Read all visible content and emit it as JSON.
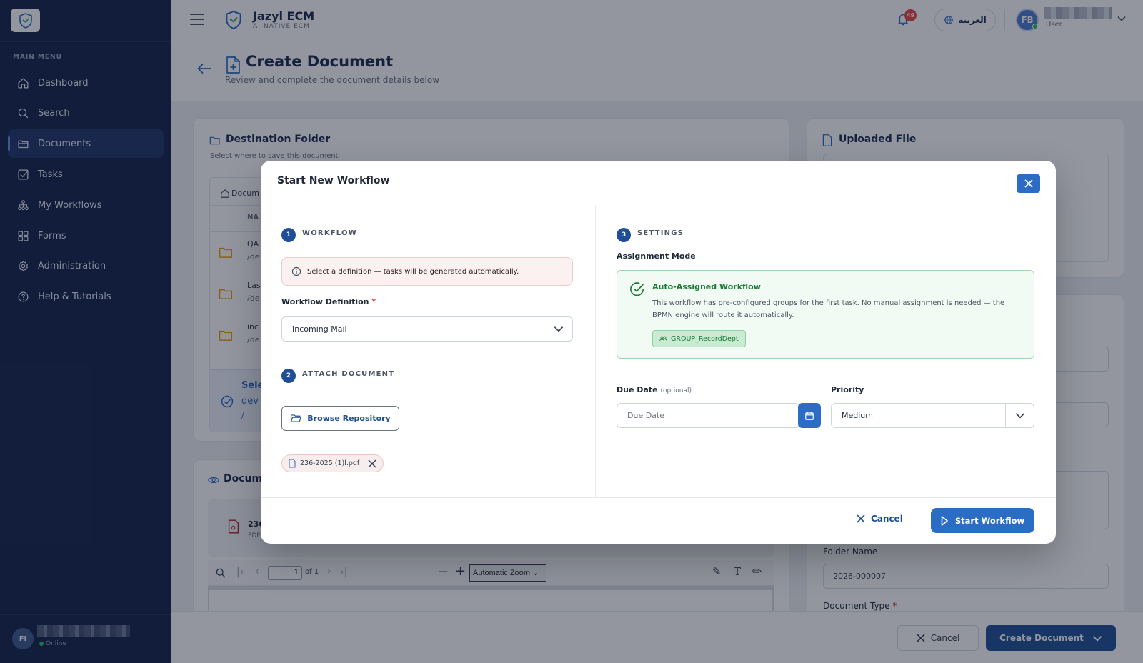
{
  "sidebar": {
    "menu_label": "MAIN MENU",
    "items": [
      {
        "label": "Dashboard",
        "icon": "home-icon"
      },
      {
        "label": "Search",
        "icon": "search-icon"
      },
      {
        "label": "Documents",
        "icon": "folder-icon",
        "active": true
      },
      {
        "label": "Tasks",
        "icon": "checkbox-icon"
      },
      {
        "label": "My Workflows",
        "icon": "workflow-icon"
      },
      {
        "label": "Forms",
        "icon": "grid-icon"
      },
      {
        "label": "Administration",
        "icon": "gear-icon"
      },
      {
        "label": "Help & Tutorials",
        "icon": "help-icon"
      }
    ],
    "user": {
      "initials": "FI",
      "status": "Online"
    }
  },
  "header": {
    "brand_name": "Jazyl ECM",
    "brand_sub": "AI-NATIVE ECM",
    "notification_count": "49",
    "language_button": "العربية",
    "user_initials": "FB",
    "user_role": "User"
  },
  "page": {
    "title": "Create Document",
    "subtitle": "Review and complete the document details below",
    "destination": {
      "title": "Destination Folder",
      "subtitle": "Select where to save this document",
      "breadcrumb": "Docum",
      "col_header": "NA",
      "rows": [
        {
          "name": "QA",
          "path": "/de"
        },
        {
          "name": "Las",
          "path": "/de"
        },
        {
          "name": "inc",
          "path": "/de"
        }
      ],
      "selected_label": "Sele",
      "selected_value": "dev",
      "selected_path": "/"
    },
    "preview": {
      "title": "Docume",
      "file_name": "236",
      "file_type": "PDF",
      "page_input": "1",
      "page_of": "of 1",
      "zoom": "Automatic Zoom"
    },
    "uploaded": {
      "title": "Uploaded File"
    },
    "folder_name_label": "Folder Name",
    "folder_name_value": "2026-000007",
    "document_type_label": "Document Type",
    "required_mark": "*",
    "cancel_label": "Cancel",
    "create_label": "Create Document"
  },
  "modal": {
    "title": "Start New Workflow",
    "steps": [
      {
        "num": "1",
        "label": "WORKFLOW"
      },
      {
        "num": "2",
        "label": "ATTACH DOCUMENT"
      },
      {
        "num": "3",
        "label": "SETTINGS"
      }
    ],
    "alert_text": "Select a definition — tasks will be generated automatically.",
    "definition_label": "Workflow Definition",
    "required_mark": "*",
    "definition_value": "Incoming Mail",
    "browse_label": "Browse Repository",
    "attached_file": "236-2025 (1)l.pdf",
    "assignment_label": "Assignment Mode",
    "auto_title": "Auto-Assigned Workflow",
    "auto_desc": "This workflow has pre-configured groups for the first task. No manual assignment is needed — the BPMN engine will route it automatically.",
    "group_chip": "GROUP_RecordDept",
    "due_label": "Due Date",
    "due_optional": "(optional)",
    "due_placeholder": "Due Date",
    "priority_label": "Priority",
    "priority_value": "Medium",
    "cancel_label": "Cancel",
    "start_label": "Start Workflow"
  },
  "colors": {
    "sidebar_bg": "#15234a",
    "primary": "#2b6cc4",
    "primary_dark": "#1e4f96",
    "success": "#1b7a38",
    "danger": "#ef4444"
  }
}
